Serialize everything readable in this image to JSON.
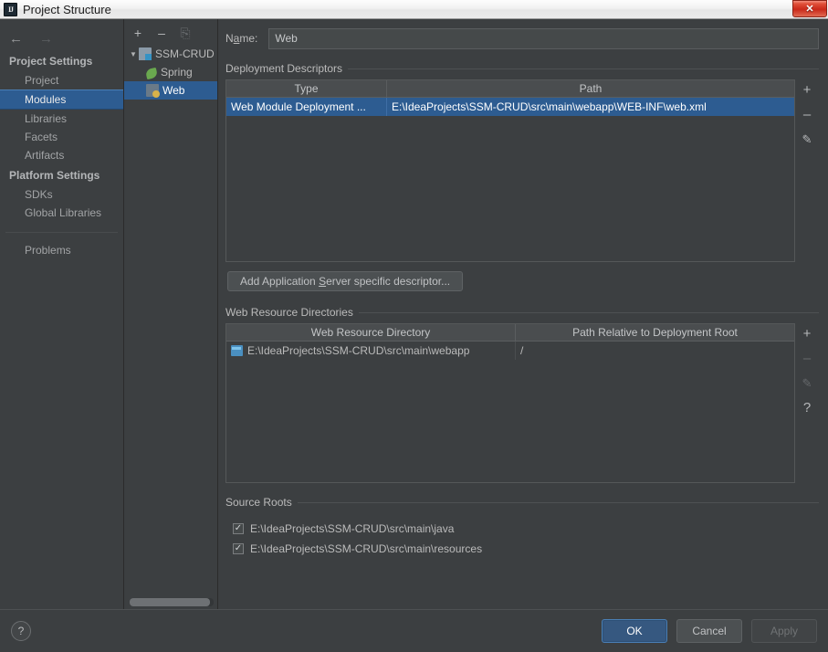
{
  "titlebar": {
    "app_icon": "intellij-idea-icon",
    "title": "Project Structure",
    "close_label": "✕"
  },
  "leftnav": {
    "back_icon": "←",
    "forward_icon": "→",
    "groups": [
      {
        "label": "Project Settings",
        "items": [
          {
            "label": "Project",
            "selected": false
          },
          {
            "label": "Modules",
            "selected": true
          },
          {
            "label": "Libraries",
            "selected": false
          },
          {
            "label": "Facets",
            "selected": false
          },
          {
            "label": "Artifacts",
            "selected": false
          }
        ]
      },
      {
        "label": "Platform Settings",
        "items": [
          {
            "label": "SDKs",
            "selected": false
          },
          {
            "label": "Global Libraries",
            "selected": false
          }
        ]
      }
    ],
    "problems_label": "Problems"
  },
  "tree": {
    "toolbar": {
      "add": "+",
      "remove": "–",
      "copy": "⎘"
    },
    "nodes": [
      {
        "label": "SSM-CRUD",
        "icon": "module-icon",
        "level": 1,
        "expanded": true,
        "selected": false
      },
      {
        "label": "Spring",
        "icon": "spring-leaf-icon",
        "level": 2,
        "selected": false
      },
      {
        "label": "Web",
        "icon": "web-facet-icon",
        "level": 2,
        "selected": true
      }
    ]
  },
  "main": {
    "name_label_pre": "N",
    "name_label_mn": "a",
    "name_label_post": "me:",
    "name_value": "Web",
    "deployment": {
      "section_title": "Deployment Descriptors",
      "columns": [
        "Type",
        "Path"
      ],
      "rows": [
        {
          "type": "Web Module Deployment ...",
          "path": "E:\\IdeaProjects\\SSM-CRUD\\src\\main\\webapp\\WEB-INF\\web.xml",
          "selected": true
        }
      ],
      "buttons": {
        "add": "+",
        "remove": "–",
        "edit": "✎"
      },
      "add_descriptor_pre": "Add Application ",
      "add_descriptor_mn": "S",
      "add_descriptor_post": "erver specific descriptor..."
    },
    "webres": {
      "section_title": "Web Resource Directories",
      "columns": [
        "Web Resource Directory",
        "Path Relative to Deployment Root"
      ],
      "rows": [
        {
          "dir": "E:\\IdeaProjects\\SSM-CRUD\\src\\main\\webapp",
          "relative": "/"
        }
      ],
      "buttons": {
        "add": "+",
        "remove": "–",
        "edit": "✎",
        "help": "?"
      }
    },
    "sourceroots": {
      "section_title": "Source Roots",
      "items": [
        {
          "label": "E:\\IdeaProjects\\SSM-CRUD\\src\\main\\java",
          "checked": true
        },
        {
          "label": "E:\\IdeaProjects\\SSM-CRUD\\src\\main\\resources",
          "checked": true
        }
      ],
      "check_glyph": "✓"
    }
  },
  "footer": {
    "help": "?",
    "ok": "OK",
    "cancel": "Cancel",
    "apply": "Apply"
  },
  "colors": {
    "background": "#3c3f41",
    "selection": "#2d5c91",
    "accent": "#365880",
    "text": "#bbbbbb"
  }
}
